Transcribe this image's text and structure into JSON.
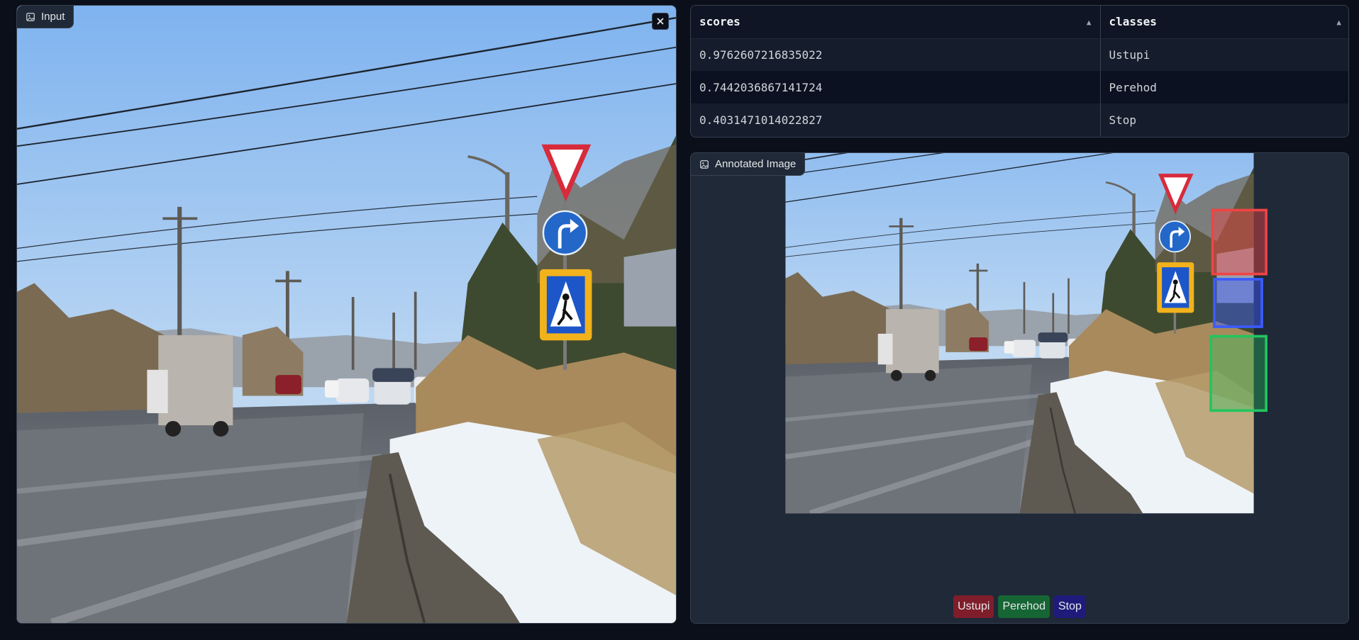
{
  "input_panel": {
    "label": "Input",
    "label_icon": "image-icon",
    "close_icon": "close-icon"
  },
  "results_table": {
    "columns": [
      "scores",
      "classes"
    ],
    "rows": [
      {
        "score": "0.9762607216835022",
        "class": "Ustupi"
      },
      {
        "score": "0.7442036867141724",
        "class": "Perehod"
      },
      {
        "score": "0.4031471014022827",
        "class": "Stop"
      }
    ]
  },
  "annotated_panel": {
    "label": "Annotated Image",
    "label_icon": "image-icon",
    "legend": [
      {
        "label": "Ustupi",
        "color": "#7f1d2a"
      },
      {
        "label": "Perehod",
        "color": "#166534"
      },
      {
        "label": "Stop",
        "color": "#1e1b7a"
      }
    ]
  },
  "colors": {
    "background": "#0b0f19",
    "panel": "#1f2937",
    "border": "#374151",
    "box_ustupi": "#ef4444",
    "box_perehod": "#3b5bff",
    "box_stop": "#22c55e"
  }
}
